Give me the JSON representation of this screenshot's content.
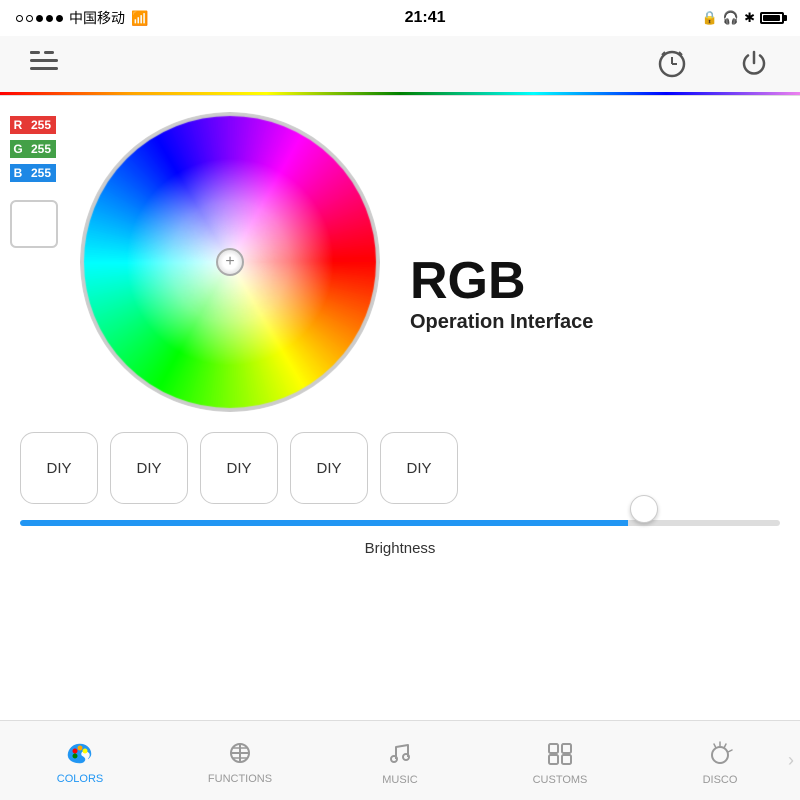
{
  "statusBar": {
    "carrier": "中国移动",
    "time": "21:41",
    "rightIcons": [
      "lock",
      "bluetooth",
      "battery"
    ]
  },
  "nav": {
    "menuIcon": "☰",
    "alarmIcon": "⏰",
    "powerIcon": "⏻"
  },
  "rgbValues": {
    "rLabel": "R",
    "gLabel": "G",
    "bLabel": "B",
    "rValue": "255",
    "gValue": "255",
    "bValue": "255"
  },
  "rgbInfo": {
    "title": "RGB",
    "subtitle": "Operation Interface"
  },
  "diyButtons": [
    {
      "label": "DIY"
    },
    {
      "label": "DIY"
    },
    {
      "label": "DIY"
    },
    {
      "label": "DIY"
    },
    {
      "label": "DIY"
    }
  ],
  "brightness": {
    "label": "Brightness",
    "value": 80
  },
  "bottomNav": {
    "items": [
      {
        "label": "COLORS",
        "icon": "colors",
        "active": true
      },
      {
        "label": "FUNCTIONS",
        "icon": "functions",
        "active": false
      },
      {
        "label": "MUSIC",
        "icon": "music",
        "active": false
      },
      {
        "label": "CUSTOMS",
        "icon": "customs",
        "active": false
      },
      {
        "label": "DISCO",
        "icon": "disco",
        "active": false
      }
    ]
  }
}
